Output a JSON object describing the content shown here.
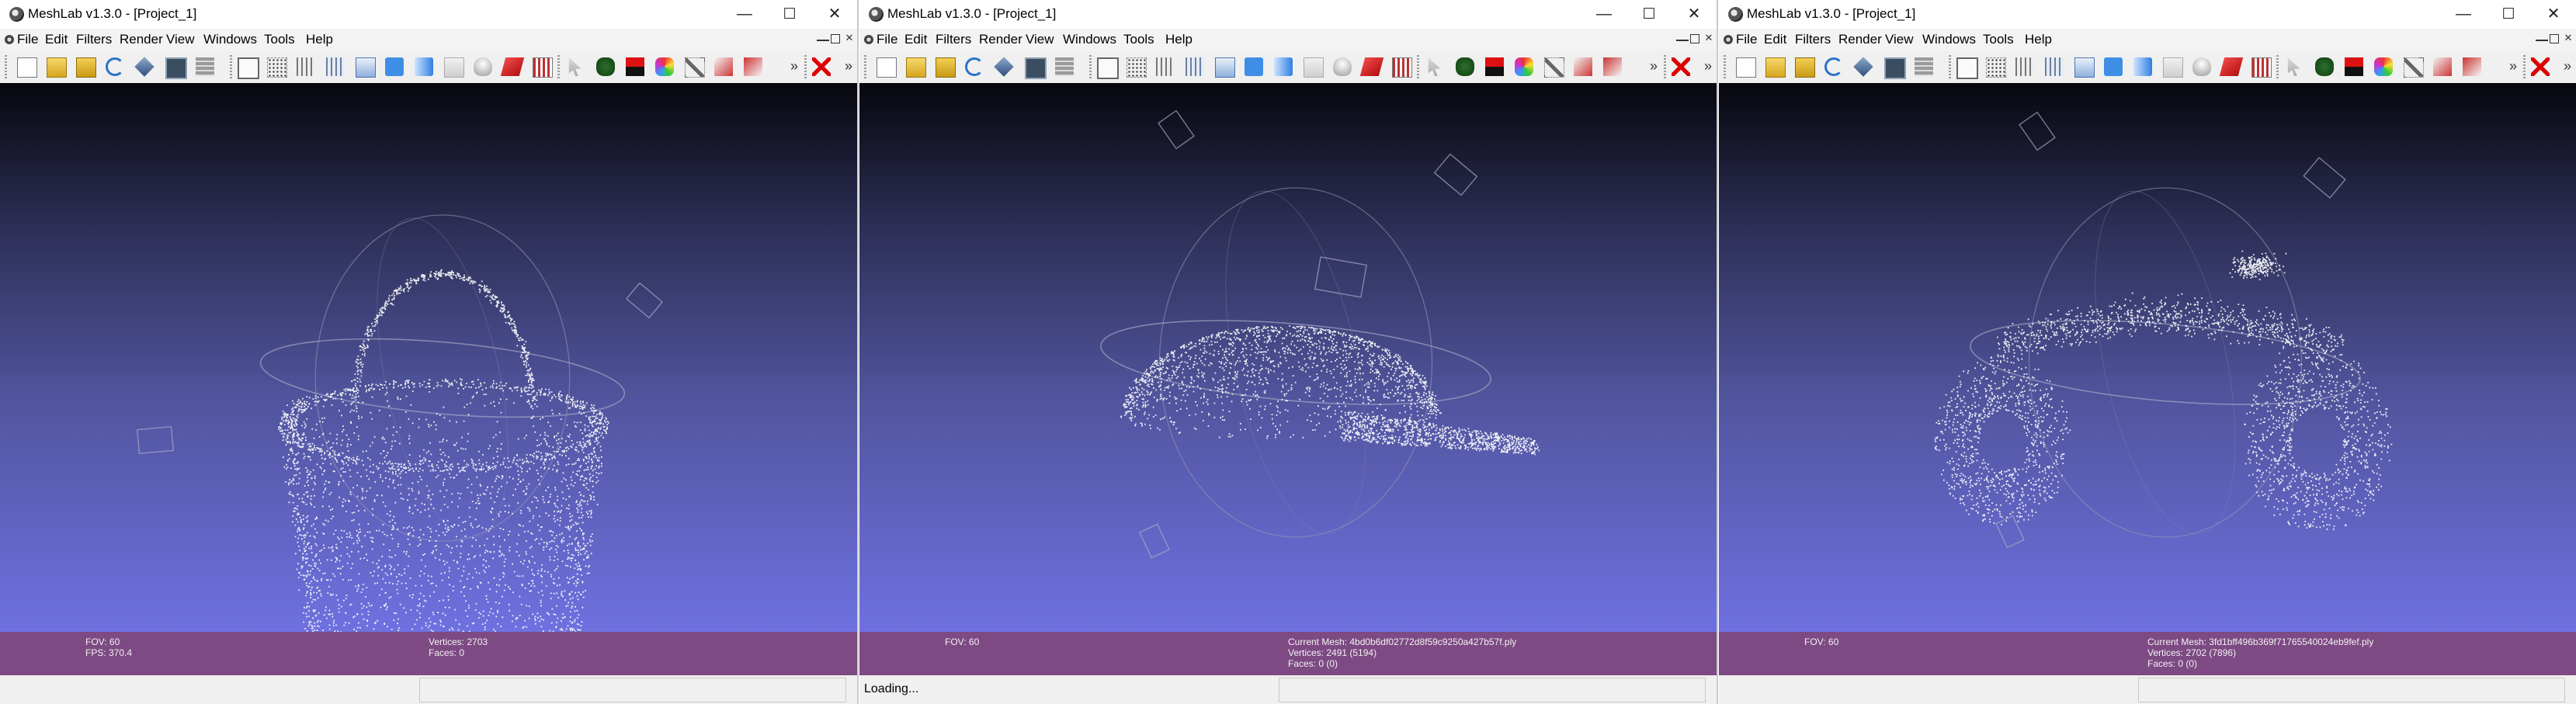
{
  "windows": [
    {
      "title": "MeshLab v1.3.0 - [Project_1]",
      "menu": [
        "File",
        "Edit",
        "Filters",
        "Render",
        "View",
        "Windows",
        "Tools",
        "Help"
      ],
      "info": {
        "fov": "FOV: 60",
        "fps": "FPS:   370.4",
        "current_mesh": "",
        "vertices": "Vertices: 2703",
        "faces": "Faces: 0"
      },
      "status": "",
      "object": "basket"
    },
    {
      "title": "MeshLab v1.3.0 - [Project_1]",
      "menu": [
        "File",
        "Edit",
        "Filters",
        "Render",
        "View",
        "Windows",
        "Tools",
        "Help"
      ],
      "info": {
        "fov": "FOV: 60",
        "fps": "",
        "current_mesh": "Current Mesh: 4bd0b6df02772d8f59c9250a427b57f.ply",
        "vertices": "Vertices: 2491 (5194)",
        "faces": "Faces: 0 (0)"
      },
      "status": "Loading...",
      "object": "cap"
    },
    {
      "title": "MeshLab v1.3.0 - [Project_1]",
      "menu": [
        "File",
        "Edit",
        "Filters",
        "Render",
        "View",
        "Windows",
        "Tools",
        "Help"
      ],
      "info": {
        "fov": "FOV: 60",
        "fps": "",
        "current_mesh": "Current Mesh: 3fd1bff496b369f71765540024eb9fef.ply",
        "vertices": "Vertices: 2702 (7896)",
        "faces": "Faces: 0 (0)"
      },
      "status": "",
      "object": "motorbike"
    }
  ],
  "window_controls": {
    "minimize": "—",
    "maximize": "☐",
    "close": "✕"
  },
  "toolbar_icons": [
    "new-project-icon",
    "open-project-icon",
    "open-mesh-icon",
    "reload-icon",
    "save-icon",
    "snapshot-icon",
    "layers-icon",
    "bbox-icon",
    "points-icon",
    "wireframe-icon",
    "hidden-lines-icon",
    "flat-lines-icon",
    "flat-icon",
    "smooth-icon",
    "texture-icon",
    "light-icon",
    "color-icon",
    "doublesided-icon",
    "select-icon",
    "align-icon",
    "paint-icon",
    "color-picker-icon",
    "measure-icon",
    "select-faces-icon",
    "select-vertices-icon",
    "delete-icon"
  ],
  "colors": {
    "info_bar": "#7d4a83",
    "viewport_top": "#07070e",
    "viewport_bottom": "#6e71e0",
    "points": "#ffffff"
  }
}
